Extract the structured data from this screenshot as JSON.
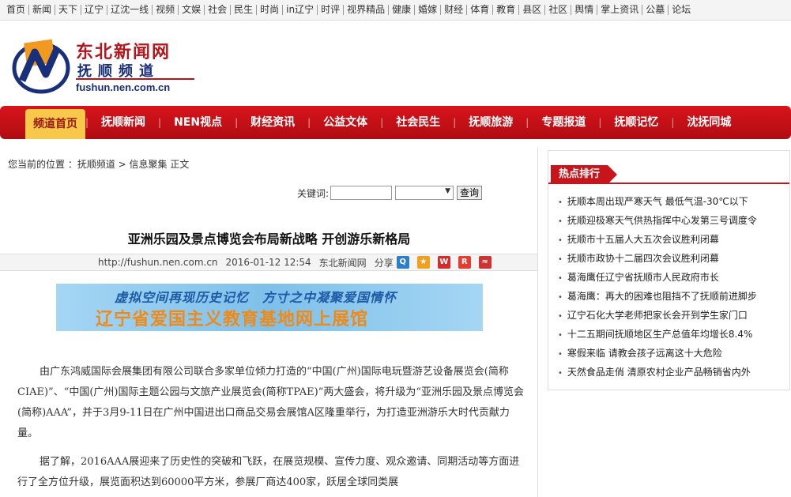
{
  "topnav": [
    "首页",
    "新闻",
    "天下",
    "辽宁",
    "辽沈一线",
    "视频",
    "文娱",
    "社会",
    "民生",
    "时尚",
    "in辽宁",
    "时评",
    "视界精品",
    "健康",
    "婚嫁",
    "财经",
    "体育",
    "教育",
    "县区",
    "社区",
    "舆情",
    "掌上资讯",
    "公墓",
    "论坛"
  ],
  "logo": {
    "title": "东北新闻网",
    "subtitle": "抚顺频道",
    "domain": "fushun.nen.com.cn"
  },
  "mainnav": [
    "频道首页",
    "抚顺新闻",
    "NEN视点",
    "财经资讯",
    "公益文体",
    "社会民生",
    "抚顺旅游",
    "专题报道",
    "抚顺记忆",
    "沈抚同城"
  ],
  "breadcrumb": "您当前的位置 ：抚顺频道 > 信息聚集 正文",
  "search": {
    "label": "关键词:",
    "button": "查询"
  },
  "article": {
    "title": "亚洲乐园及景点博览会布局新战略 开创游乐新格局",
    "url": "http://fushun.nen.com.cn",
    "datetime": "2016-01-12 12:54",
    "source": "东北新闻网",
    "share_label": "分享",
    "banner_line1": "虚拟空间再现历史记忆　方寸之中凝聚爱国情怀",
    "banner_line2": "辽宁省爱国主义教育基地网上展馆",
    "para1": "由广东鸿威国际会展集团有限公司联合多家单位倾力打造的“中国(广州)国际电玩暨游艺设备展览会(简称CIAE)”、“中国(广州)国际主题公园与文旅产业展览会(简称TPAE)”两大盛会，将升级为“亚洲乐园及景点博览会(简称)AAA”，并于3月9-11日在广州中国进出口商品交易会展馆A区隆重举行，为打造亚洲游乐大时代贡献力量。",
    "para2": "据了解，2016AAA展迎来了历史性的突破和飞跃，在展览规模、宣传力度、观众邀请、同期活动等方面进行了全方位升级，展览面积达到60000平方米，参展厂商达400家，跃居全球同类展"
  },
  "hot": {
    "header": "热点排行",
    "items": [
      "抚顺本周出现严寒天气 最低气温-30℃以下",
      "抚顺迎极寒天气供热指挥中心发第三号调度令",
      "抚顺市十五届人大五次会议胜利闭幕",
      "抚顺市政协十二届四次会议胜利闭幕",
      "葛海鹰任辽宁省抚顺市人民政府市长",
      "葛海鹰：再大的困难也阻挡不了抚顺前进脚步",
      "辽宁石化大学老师把家长会开到学生家门口",
      "十二五期间抚顺地区生产总值年均增长8.4%",
      "寒假来临 请教会孩子远离这十大危险",
      "天然食品走俏 清原农村企业产品畅销省内外"
    ]
  },
  "colors": {
    "brand_red": "#c8141b",
    "nav_active": "#f7c84a",
    "logo_blue": "#1a2f7a"
  }
}
